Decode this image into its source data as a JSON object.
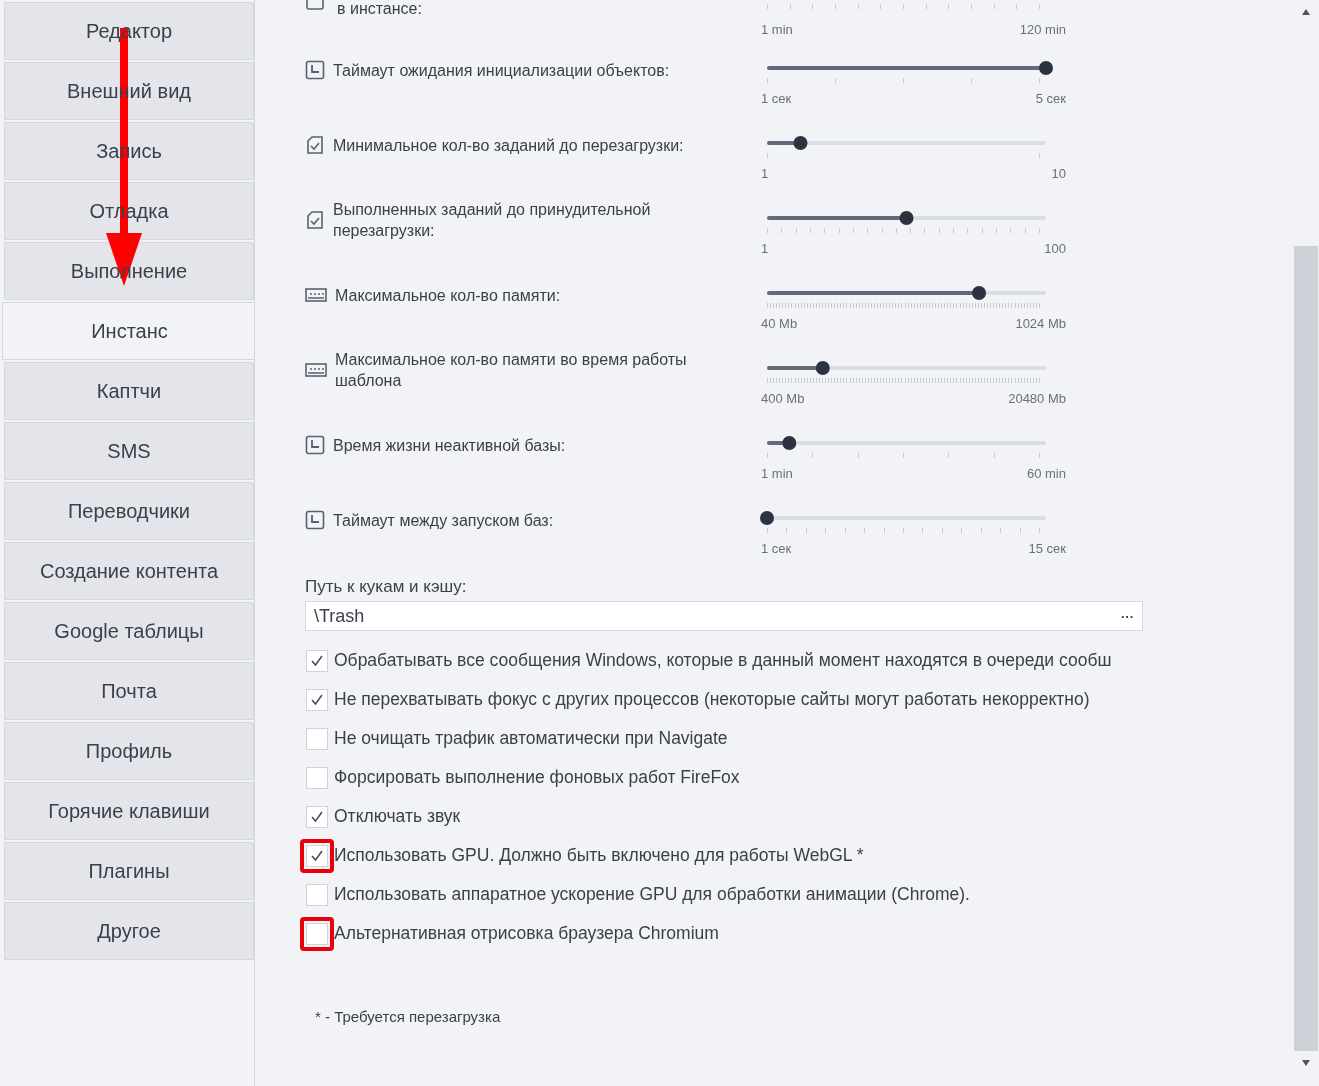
{
  "sidebar": {
    "items": [
      {
        "label": "Редактор",
        "selected": false
      },
      {
        "label": "Внешний вид",
        "selected": false
      },
      {
        "label": "Запись",
        "selected": false
      },
      {
        "label": "Отладка",
        "selected": false
      },
      {
        "label": "Выполнение",
        "selected": false
      },
      {
        "label": "Инстанс",
        "selected": true
      },
      {
        "label": "Каптчи",
        "selected": false
      },
      {
        "label": "SMS",
        "selected": false
      },
      {
        "label": "Переводчики",
        "selected": false
      },
      {
        "label": "Создание контента",
        "selected": false
      },
      {
        "label": "Google таблицы",
        "selected": false
      },
      {
        "label": "Почта",
        "selected": false
      },
      {
        "label": "Профиль",
        "selected": false
      },
      {
        "label": "Горячие клавиши",
        "selected": false
      },
      {
        "label": "Плагины",
        "selected": false
      },
      {
        "label": "Другое",
        "selected": false
      }
    ]
  },
  "partial_setting": {
    "label": "в инстансе:",
    "min_label": "1 min",
    "max_label": "120 min"
  },
  "sliders": [
    {
      "label": "Таймаут ожидания инициализации объектов:",
      "level": 1.0,
      "min_label": "1 сек",
      "max_label": "5 сек"
    },
    {
      "label": "Минимальное кол-во заданий до перезагрузки:",
      "level": 0.12,
      "min_label": "1",
      "max_label": "10"
    },
    {
      "label": "Выполненных заданий до принудительной перезагрузки:",
      "level": 0.5,
      "min_label": "1",
      "max_label": "100"
    },
    {
      "label": "Максимальное кол-во памяти:",
      "level": 0.76,
      "min_label": "40 Mb",
      "max_label": "1024 Mb"
    },
    {
      "label": "Максимальное кол-во памяти во время работы шаблона",
      "level": 0.2,
      "min_label": "400 Mb",
      "max_label": "20480 Mb"
    },
    {
      "label": "Время жизни неактивной базы:",
      "level": 0.08,
      "min_label": "1 min",
      "max_label": "60 min"
    },
    {
      "label": "Таймаут между запуском баз:",
      "level": 0.0,
      "min_label": "1 сек",
      "max_label": "15 сек"
    }
  ],
  "cache_path": {
    "label": "Путь к кукам и кэшу:",
    "value": "\\Trash",
    "browse": "···"
  },
  "checkboxes": [
    {
      "label": "Обрабатывать все сообщения Windows, которые в данный момент находятся в очереди сообш",
      "checked": true,
      "highlighted": false
    },
    {
      "label": "Не перехватывать фокус с других процессов (некоторые сайты могут работать некорректно)",
      "checked": true,
      "highlighted": false
    },
    {
      "label": "Не очищать трафик автоматически при Navigate",
      "checked": false,
      "highlighted": false
    },
    {
      "label": "Форсировать выполнение фоновых работ FireFox",
      "checked": false,
      "highlighted": false
    },
    {
      "label": "Отключать звук",
      "checked": true,
      "highlighted": false
    },
    {
      "label": "Использовать GPU. Должно быть включено для работы WebGL *",
      "checked": true,
      "highlighted": true
    },
    {
      "label": "Использовать аппаратное ускорение GPU для обработки анимации (Chrome).",
      "checked": false,
      "highlighted": false
    },
    {
      "label": "Альтернативная отрисовка браузера Chromium",
      "checked": false,
      "highlighted": true
    }
  ],
  "footnote": "* - Требуется перезагрузка"
}
